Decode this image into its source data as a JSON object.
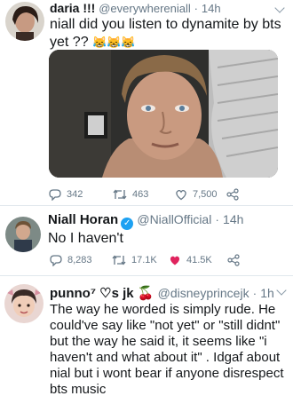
{
  "tweet1": {
    "display_name": "daria !!!",
    "handle": "@everywhereniall",
    "time": "14h",
    "text_line1": "niall did you listen to dynamite by bts",
    "text_line2": "yet ??",
    "emoji": "😹😹😹",
    "replies": "342",
    "retweets": "463",
    "likes": "7,500"
  },
  "tweet2": {
    "display_name": "Niall Horan",
    "handle": "@NiallOfficial",
    "time": "14h",
    "text": "No I haven't",
    "replies": "8,283",
    "retweets": "17.1K",
    "likes": "41.5K"
  },
  "tweet3": {
    "display_name": "punno⁷ ♡s jk 🍒",
    "handle": "@disneyprincejk",
    "time": "1h",
    "lines": [
      "The way he worded is simply rude. He",
      "could've say like \"not yet\" or \"still didnt\"",
      "but the way he said it, it seems like \"i",
      "haven't and what about it\" . Idgaf about",
      "nial but i wont bear if anyone disrespect",
      "bts music"
    ]
  },
  "colors": {
    "like_red": "#e0245e",
    "verified_blue": "#1da1f2",
    "muted": "#657786"
  }
}
